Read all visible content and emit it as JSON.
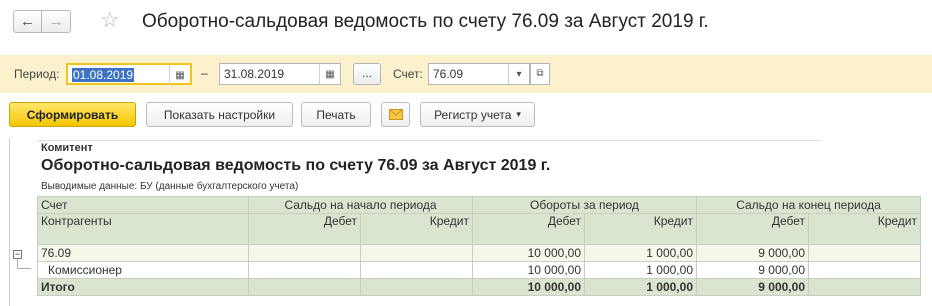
{
  "window": {
    "title": "Оборотно-сальдовая ведомость по счету 76.09 за Август 2019 г.",
    "back_icon": "arrow-left-icon",
    "forward_icon": "arrow-right-icon",
    "favorite_icon": "star-icon"
  },
  "params": {
    "period_label": "Период:",
    "date_from": "01.08.2019",
    "dash": "–",
    "date_to": "31.08.2019",
    "choose_period": "...",
    "account_label": "Счет:",
    "account_value": "76.09"
  },
  "toolbar": {
    "generate": "Сформировать",
    "settings": "Показать настройки",
    "print": "Печать",
    "mail_icon": "envelope-icon",
    "register": "Регистр учета"
  },
  "report": {
    "grouping_label": "Комитент",
    "title": "Оборотно-сальдовая ведомость по счету 76.09 за Август 2019 г.",
    "output_data": "Выводимые данные:  БУ (данные бухгалтерского учета)",
    "headers": {
      "account": "Счет",
      "counterparties": "Контрагенты",
      "opening": "Сальдо на начало периода",
      "turnover": "Обороты за период",
      "closing": "Сальдо на конец периода",
      "debit": "Дебет",
      "credit": "Кредит"
    },
    "rows": [
      {
        "name": "76.09",
        "open_dt": "",
        "open_kt": "",
        "turn_dt": "10 000,00",
        "turn_kt": "1 000,00",
        "close_dt": "9 000,00",
        "close_kt": ""
      },
      {
        "name": "Комиссионер",
        "open_dt": "",
        "open_kt": "",
        "turn_dt": "10 000,00",
        "turn_kt": "1 000,00",
        "close_dt": "9 000,00",
        "close_kt": ""
      }
    ],
    "total": {
      "name": "Итого",
      "open_dt": "",
      "open_kt": "",
      "turn_dt": "10 000,00",
      "turn_kt": "1 000,00",
      "close_dt": "9 000,00",
      "close_kt": ""
    }
  },
  "colors": {
    "params_bg": "#fbf2cd",
    "primary_button": "#f3c500",
    "table_header": "#d9e5d1"
  }
}
